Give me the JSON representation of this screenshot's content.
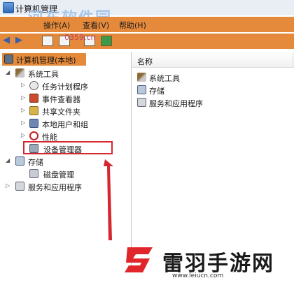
{
  "window": {
    "title": "计算机管理"
  },
  "watermark": {
    "text": "河东软件园",
    "url": "0359.cn"
  },
  "menu": {
    "items": [
      "操作(A)",
      "查看(V)",
      "帮助(H)"
    ]
  },
  "toolbar": {
    "buttons": [
      "back-icon",
      "forward-icon",
      "console-tree-icon",
      "properties-icon",
      "help-icon",
      "show-hide-icon"
    ]
  },
  "tree": {
    "root": "计算机管理(本地)",
    "system_tools": "系统工具",
    "task_scheduler": "任务计划程序",
    "event_viewer": "事件查看器",
    "shared_folders": "共享文件夹",
    "local_users": "本地用户和组",
    "performance": "性能",
    "device_manager": "设备管理器",
    "storage": "存储",
    "disk_management": "磁盘管理",
    "services_apps": "服务和应用程序"
  },
  "list": {
    "column_name": "名称",
    "items": [
      "系统工具",
      "存储",
      "服务和应用程序"
    ]
  },
  "logo": {
    "text": "雷羽手游网",
    "url": "www.leiucn.com"
  },
  "colors": {
    "accent_orange": "#e58a3b",
    "highlight_red": "#d6262f"
  }
}
